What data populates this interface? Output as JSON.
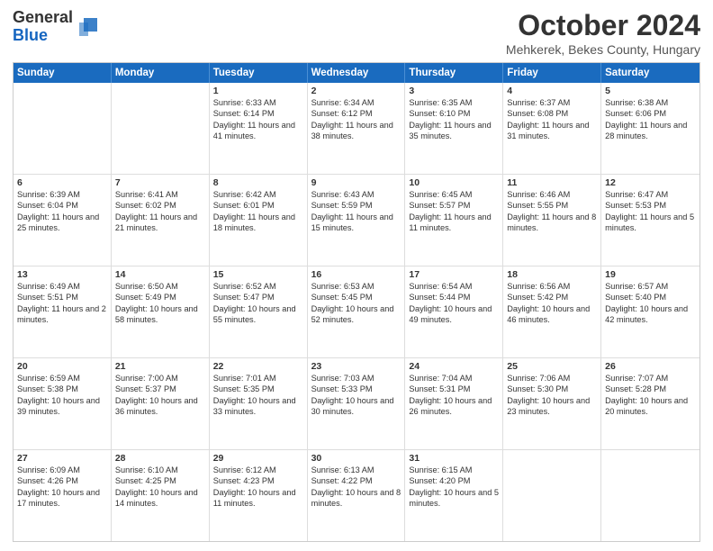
{
  "logo": {
    "general": "General",
    "blue": "Blue"
  },
  "title": "October 2024",
  "subtitle": "Mehkerek, Bekes County, Hungary",
  "header_days": [
    "Sunday",
    "Monday",
    "Tuesday",
    "Wednesday",
    "Thursday",
    "Friday",
    "Saturday"
  ],
  "rows": [
    [
      {
        "day": "",
        "text": ""
      },
      {
        "day": "",
        "text": ""
      },
      {
        "day": "1",
        "text": "Sunrise: 6:33 AM\nSunset: 6:14 PM\nDaylight: 11 hours and 41 minutes."
      },
      {
        "day": "2",
        "text": "Sunrise: 6:34 AM\nSunset: 6:12 PM\nDaylight: 11 hours and 38 minutes."
      },
      {
        "day": "3",
        "text": "Sunrise: 6:35 AM\nSunset: 6:10 PM\nDaylight: 11 hours and 35 minutes."
      },
      {
        "day": "4",
        "text": "Sunrise: 6:37 AM\nSunset: 6:08 PM\nDaylight: 11 hours and 31 minutes."
      },
      {
        "day": "5",
        "text": "Sunrise: 6:38 AM\nSunset: 6:06 PM\nDaylight: 11 hours and 28 minutes."
      }
    ],
    [
      {
        "day": "6",
        "text": "Sunrise: 6:39 AM\nSunset: 6:04 PM\nDaylight: 11 hours and 25 minutes."
      },
      {
        "day": "7",
        "text": "Sunrise: 6:41 AM\nSunset: 6:02 PM\nDaylight: 11 hours and 21 minutes."
      },
      {
        "day": "8",
        "text": "Sunrise: 6:42 AM\nSunset: 6:01 PM\nDaylight: 11 hours and 18 minutes."
      },
      {
        "day": "9",
        "text": "Sunrise: 6:43 AM\nSunset: 5:59 PM\nDaylight: 11 hours and 15 minutes."
      },
      {
        "day": "10",
        "text": "Sunrise: 6:45 AM\nSunset: 5:57 PM\nDaylight: 11 hours and 11 minutes."
      },
      {
        "day": "11",
        "text": "Sunrise: 6:46 AM\nSunset: 5:55 PM\nDaylight: 11 hours and 8 minutes."
      },
      {
        "day": "12",
        "text": "Sunrise: 6:47 AM\nSunset: 5:53 PM\nDaylight: 11 hours and 5 minutes."
      }
    ],
    [
      {
        "day": "13",
        "text": "Sunrise: 6:49 AM\nSunset: 5:51 PM\nDaylight: 11 hours and 2 minutes."
      },
      {
        "day": "14",
        "text": "Sunrise: 6:50 AM\nSunset: 5:49 PM\nDaylight: 10 hours and 58 minutes."
      },
      {
        "day": "15",
        "text": "Sunrise: 6:52 AM\nSunset: 5:47 PM\nDaylight: 10 hours and 55 minutes."
      },
      {
        "day": "16",
        "text": "Sunrise: 6:53 AM\nSunset: 5:45 PM\nDaylight: 10 hours and 52 minutes."
      },
      {
        "day": "17",
        "text": "Sunrise: 6:54 AM\nSunset: 5:44 PM\nDaylight: 10 hours and 49 minutes."
      },
      {
        "day": "18",
        "text": "Sunrise: 6:56 AM\nSunset: 5:42 PM\nDaylight: 10 hours and 46 minutes."
      },
      {
        "day": "19",
        "text": "Sunrise: 6:57 AM\nSunset: 5:40 PM\nDaylight: 10 hours and 42 minutes."
      }
    ],
    [
      {
        "day": "20",
        "text": "Sunrise: 6:59 AM\nSunset: 5:38 PM\nDaylight: 10 hours and 39 minutes."
      },
      {
        "day": "21",
        "text": "Sunrise: 7:00 AM\nSunset: 5:37 PM\nDaylight: 10 hours and 36 minutes."
      },
      {
        "day": "22",
        "text": "Sunrise: 7:01 AM\nSunset: 5:35 PM\nDaylight: 10 hours and 33 minutes."
      },
      {
        "day": "23",
        "text": "Sunrise: 7:03 AM\nSunset: 5:33 PM\nDaylight: 10 hours and 30 minutes."
      },
      {
        "day": "24",
        "text": "Sunrise: 7:04 AM\nSunset: 5:31 PM\nDaylight: 10 hours and 26 minutes."
      },
      {
        "day": "25",
        "text": "Sunrise: 7:06 AM\nSunset: 5:30 PM\nDaylight: 10 hours and 23 minutes."
      },
      {
        "day": "26",
        "text": "Sunrise: 7:07 AM\nSunset: 5:28 PM\nDaylight: 10 hours and 20 minutes."
      }
    ],
    [
      {
        "day": "27",
        "text": "Sunrise: 6:09 AM\nSunset: 4:26 PM\nDaylight: 10 hours and 17 minutes."
      },
      {
        "day": "28",
        "text": "Sunrise: 6:10 AM\nSunset: 4:25 PM\nDaylight: 10 hours and 14 minutes."
      },
      {
        "day": "29",
        "text": "Sunrise: 6:12 AM\nSunset: 4:23 PM\nDaylight: 10 hours and 11 minutes."
      },
      {
        "day": "30",
        "text": "Sunrise: 6:13 AM\nSunset: 4:22 PM\nDaylight: 10 hours and 8 minutes."
      },
      {
        "day": "31",
        "text": "Sunrise: 6:15 AM\nSunset: 4:20 PM\nDaylight: 10 hours and 5 minutes."
      },
      {
        "day": "",
        "text": ""
      },
      {
        "day": "",
        "text": ""
      }
    ]
  ]
}
